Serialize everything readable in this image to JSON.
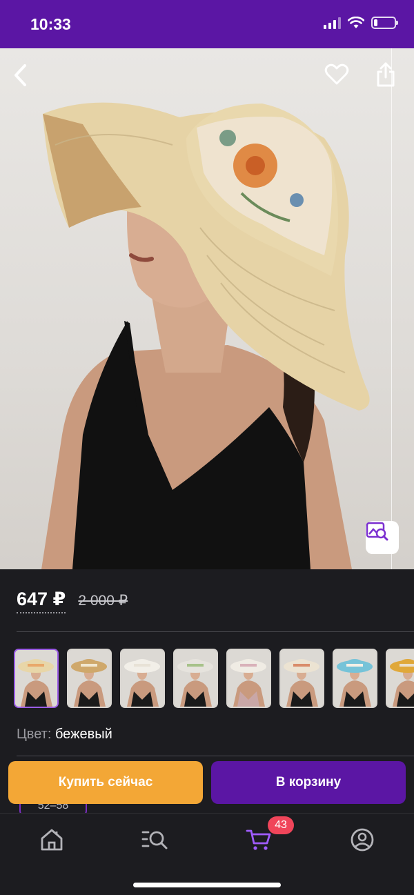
{
  "status_bar": {
    "time": "10:33",
    "battery_level": 0.18
  },
  "product": {
    "price": "647 ₽",
    "old_price": "2 000 ₽",
    "color_label": "Цвет:",
    "color_value": "бежевый",
    "size_chip": "52–58"
  },
  "variants": [
    {
      "label": "beige",
      "hat": "#e8d6a8",
      "band": "#e9a86a",
      "dress": "#1a1a1a"
    },
    {
      "label": "straw",
      "hat": "#cfa86b",
      "band": "#f1e7d0",
      "dress": "#1a1a1a"
    },
    {
      "label": "white",
      "hat": "#f2efe8",
      "band": "#e8e2d6",
      "dress": "#1a1a1a"
    },
    {
      "label": "grey-white",
      "hat": "#e6e3dd",
      "band": "#a7c28a",
      "dress": "#1a1a1a"
    },
    {
      "label": "floral",
      "hat": "#f0ece4",
      "band": "#d9b1b9",
      "dress": "#c9a7a7"
    },
    {
      "label": "light",
      "hat": "#ece3d2",
      "band": "#d98c6a",
      "dress": "#1a1a1a"
    },
    {
      "label": "blue",
      "hat": "#76c3d8",
      "band": "#f4f0e6",
      "dress": "#1a1a1a"
    },
    {
      "label": "mustard",
      "hat": "#e0a83a",
      "band": "#eadfcd",
      "dress": "#1a1a1a"
    }
  ],
  "actions": {
    "buy_now": "Купить сейчас",
    "add_to_cart": "В корзину"
  },
  "tabbar": {
    "cart_count": "43"
  },
  "colors": {
    "brand_purple": "#5b16a4",
    "buy_orange": "#f3a736",
    "badge_red": "#f0455a"
  }
}
